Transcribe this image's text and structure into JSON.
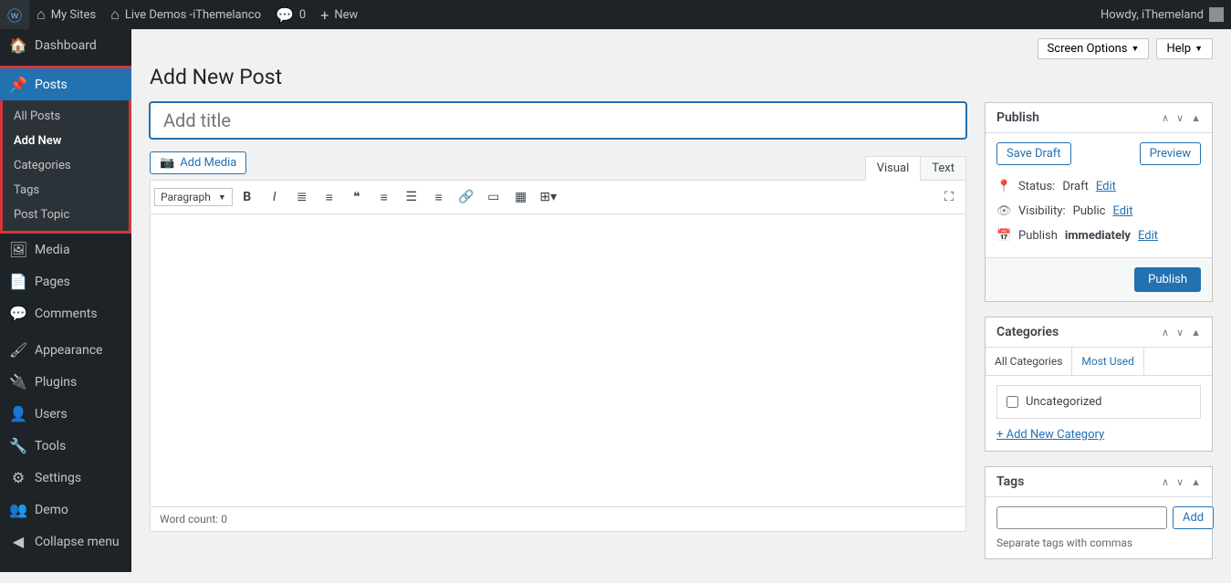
{
  "adminbar": {
    "my_sites": "My Sites",
    "site_name": "Live Demos -iThemelanco",
    "comments": "0",
    "new": "New",
    "howdy": "Howdy, iThemeland"
  },
  "sidebar": {
    "dashboard": "Dashboard",
    "posts": "Posts",
    "posts_sub": [
      "All Posts",
      "Add New",
      "Categories",
      "Tags",
      "Post Topic"
    ],
    "posts_sub_active": 1,
    "media": "Media",
    "pages": "Pages",
    "comments": "Comments",
    "appearance": "Appearance",
    "plugins": "Plugins",
    "users": "Users",
    "tools": "Tools",
    "settings": "Settings",
    "demo": "Demo",
    "collapse": "Collapse menu"
  },
  "top": {
    "screen_options": "Screen Options",
    "help": "Help"
  },
  "page": {
    "title": "Add New Post",
    "title_placeholder": "Add title",
    "add_media": "Add Media",
    "tab_visual": "Visual",
    "tab_text": "Text",
    "format_select": "Paragraph",
    "word_count_label": "Word count: ",
    "word_count": "0"
  },
  "publish": {
    "heading": "Publish",
    "save_draft": "Save Draft",
    "preview": "Preview",
    "status_label": "Status: ",
    "status_value": "Draft",
    "visibility_label": "Visibility: ",
    "visibility_value": "Public",
    "publish_label": "Publish ",
    "publish_value": "immediately",
    "edit": "Edit",
    "submit": "Publish"
  },
  "categories": {
    "heading": "Categories",
    "tab_all": "All Categories",
    "tab_most": "Most Used",
    "item": "Uncategorized",
    "add_new": "+ Add New Category"
  },
  "tags": {
    "heading": "Tags",
    "add": "Add",
    "note": "Separate tags with commas"
  }
}
